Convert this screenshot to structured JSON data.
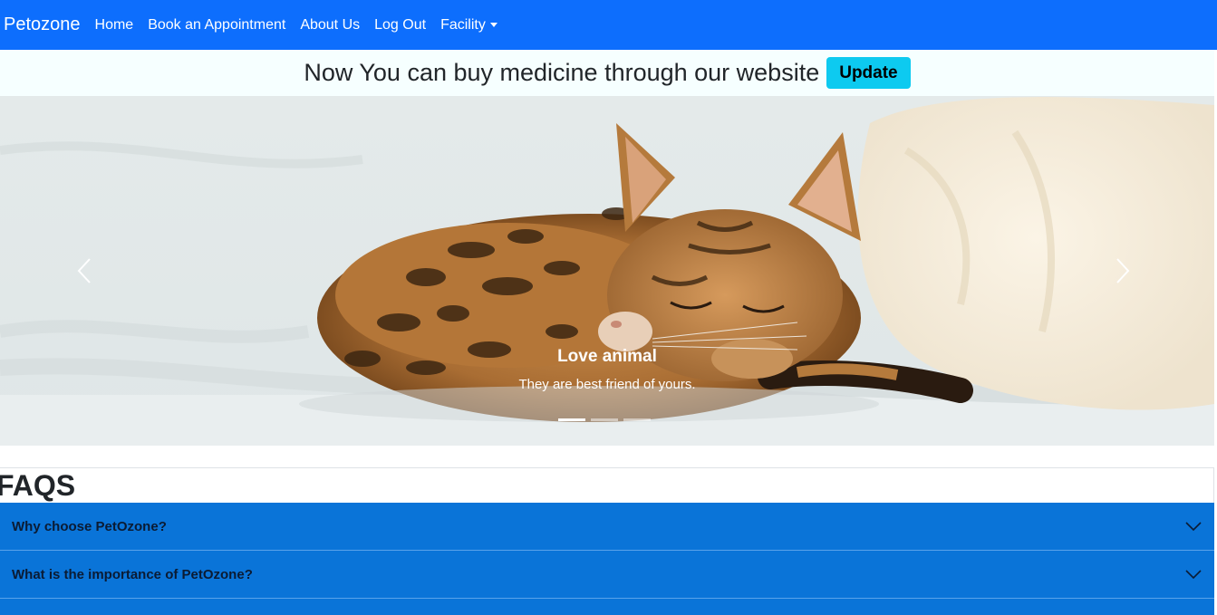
{
  "navbar": {
    "brand": "Petozone",
    "links": [
      "Home",
      "Book an Appointment",
      "About Us",
      "Log Out"
    ],
    "dropdown_label": "Facility"
  },
  "banner": {
    "text": "Now You can buy medicine through our website",
    "button_label": "Update"
  },
  "carousel": {
    "caption_title": "Love animal",
    "caption_text": "They are best friend of yours.",
    "slide_count": 3,
    "active_slide": 1
  },
  "faq": {
    "title": "FAQS",
    "items": [
      "Why choose PetOzone?",
      "What is the importance of PetOzone?"
    ]
  },
  "colors": {
    "navbar": "#0d6efd",
    "update_button": "#0dcaf0",
    "accordion": "#0a74d8"
  }
}
